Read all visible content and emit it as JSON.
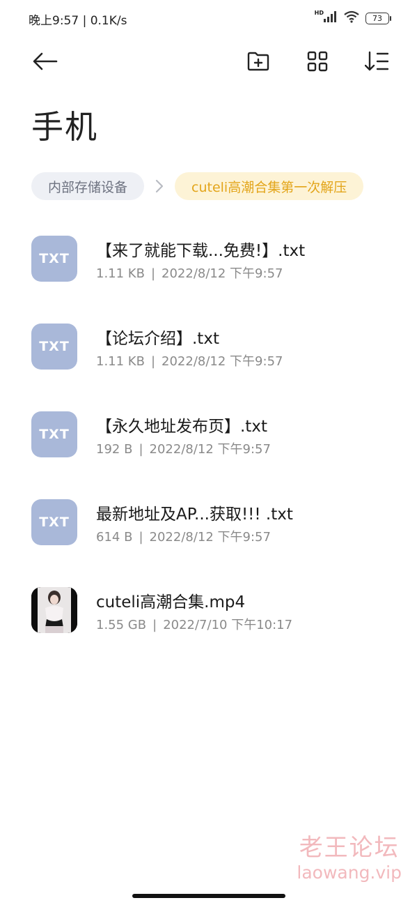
{
  "status_bar": {
    "time_speed": "晚上9:57 | 0.1K/s",
    "hd": "HD",
    "battery": "73"
  },
  "toolbar": {
    "back_icon": "arrow-left-icon",
    "new_folder_icon": "folder-plus-icon",
    "view_icon": "grid-view-icon",
    "sort_icon": "sort-icon"
  },
  "page": {
    "title": "手机"
  },
  "breadcrumb": {
    "root": "内部存储设备",
    "current": "cuteli高潮合集第一次解压"
  },
  "files": [
    {
      "name": "【来了就能下载...免费!】.txt",
      "size": "1.11 KB",
      "date": "2022/8/12 下午9:57",
      "icon": "TXT"
    },
    {
      "name": "【论坛介绍】.txt",
      "size": "1.11 KB",
      "date": "2022/8/12 下午9:57",
      "icon": "TXT"
    },
    {
      "name": "【永久地址发布页】.txt",
      "size": "192 B",
      "date": "2022/8/12 下午9:57",
      "icon": "TXT"
    },
    {
      "name": "最新地址及AP...获取!!! .txt",
      "size": "614 B",
      "date": "2022/8/12 下午9:57",
      "icon": "TXT"
    },
    {
      "name": "cuteli高潮合集.mp4",
      "size": "1.55 GB",
      "date": "2022/7/10 下午10:17",
      "icon": "video-thumbnail"
    }
  ],
  "meta_separator": "|",
  "watermark": {
    "cn": "老王论坛",
    "en": "laowang.vip"
  },
  "colors": {
    "txt_icon_bg": "#a9b8d9",
    "current_crumb_bg": "#fdf3d6",
    "current_crumb_text": "#e3a51a",
    "root_crumb_bg": "#eef0f5"
  }
}
